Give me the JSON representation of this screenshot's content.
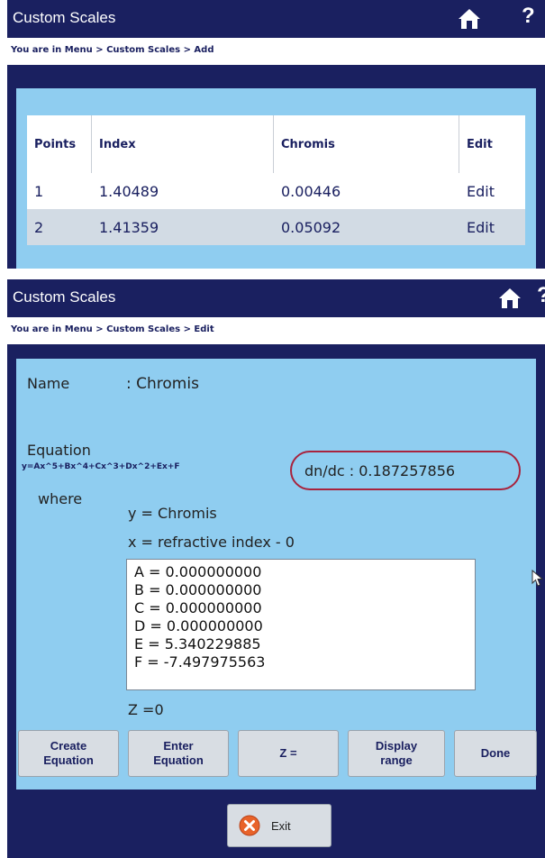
{
  "screen_add": {
    "title": "Custom Scales",
    "help_label": "?",
    "breadcrumb": "You are in Menu > Custom Scales > Add",
    "table": {
      "headers": [
        "Points",
        "Index",
        "Chromis",
        "Edit"
      ],
      "rows": [
        [
          "1",
          "1.40489",
          "0.00446",
          "Edit"
        ],
        [
          "2",
          "1.41359",
          "0.05092",
          "Edit"
        ]
      ]
    }
  },
  "screen_edit": {
    "title": "Custom Scales",
    "help_label": "?",
    "breadcrumb": "You are in Menu > Custom Scales > Edit",
    "name_label": "Name",
    "name_value": ": Chromis",
    "equation_label": "Equation",
    "equation_formula": "y=Ax^5+Bx^4+Cx^3+Dx^2+Ex+F",
    "dndc": "dn/dc : 0.187257856",
    "where_label": "where",
    "y_def": "y = Chromis",
    "x_def": "x = refractive index - 0",
    "coefficients": [
      "A = 0.000000000",
      "B = 0.000000000",
      "C = 0.000000000",
      "D = 0.000000000",
      "E = 5.340229885",
      "F = -7.497975563"
    ],
    "z_value": "Z =0",
    "buttons": {
      "create_1": "Create",
      "create_2": "Equation",
      "enter_1": "Enter",
      "enter_2": "Equation",
      "z": "Z =",
      "display_1": "Display",
      "display_2": "range",
      "done": "Done",
      "exit": "Exit"
    }
  },
  "colors": {
    "header_bg": "#1a2060",
    "content_bg": "#8fcdf0",
    "highlight_ring": "#a8233d",
    "exit_icon": "#e8632a"
  }
}
